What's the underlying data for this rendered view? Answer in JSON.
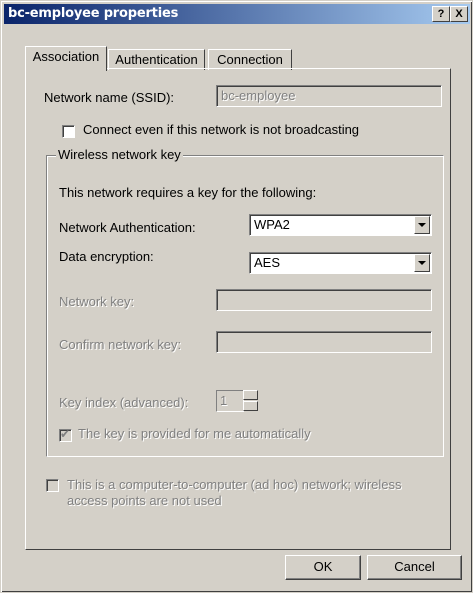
{
  "window": {
    "title": "bc-employee properties",
    "help_button": "?",
    "close_button": "X"
  },
  "tabs": [
    {
      "label": "Association",
      "active": true
    },
    {
      "label": "Authentication",
      "active": false
    },
    {
      "label": "Connection",
      "active": false
    }
  ],
  "association": {
    "ssid_label": "Network name (SSID):",
    "ssid_value": "bc-employee",
    "connect_broadcast_label": "Connect even if this network is not broadcasting",
    "connect_broadcast_checked": false,
    "wireless_group_title": "Wireless network key",
    "requires_key_text": "This network requires a key for the following:",
    "auth_label": "Network Authentication:",
    "auth_value": "WPA2",
    "encryption_label": "Data encryption:",
    "encryption_value": "AES",
    "network_key_label": "Network key:",
    "confirm_key_label": "Confirm network key:",
    "key_index_label": "Key index (advanced):",
    "key_index_value": "1",
    "key_provided_label": "The key is provided for me automatically",
    "key_provided_checked": true,
    "adhoc_label_line1": "This is a computer-to-computer (ad hoc) network; wireless",
    "adhoc_label_line2": "access points are not used",
    "adhoc_checked": false
  },
  "buttons": {
    "ok": "OK",
    "cancel": "Cancel"
  },
  "colors": {
    "title_start": "#0a246a",
    "title_end": "#a6caf0",
    "face": "#d4d0c8",
    "disabled_text": "#808080"
  }
}
